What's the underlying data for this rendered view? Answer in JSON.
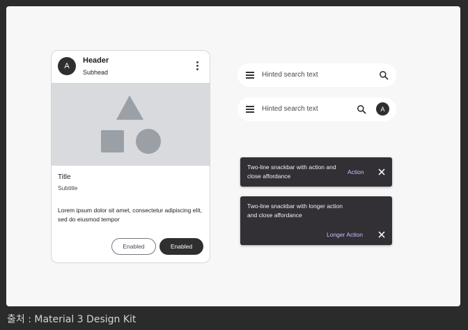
{
  "card": {
    "avatar_letter": "A",
    "header": "Header",
    "subhead": "Subhead",
    "title": "Title",
    "subtitle": "Subtitle",
    "body": "Lorem ipsum dolor sit amet, consectetur adipiscing elit, sed do eiusmod tempor",
    "outlined_button": "Enabled",
    "filled_button": "Enabled"
  },
  "search_bars": [
    {
      "hint": "Hinted search text"
    },
    {
      "hint": "Hinted search text",
      "avatar_letter": "A"
    }
  ],
  "snackbars": [
    {
      "text": "Two-line snackbar with action and close affordance",
      "action": "Action"
    },
    {
      "text": "Two-line snackbar with longer action and close affordance",
      "action": "Longer Action"
    }
  ],
  "caption": "출처 : Material 3 Design Kit",
  "colors": {
    "page_bg": "#2b2b2b",
    "canvas_bg": "#f7f7f7",
    "media_bg": "#d9dade",
    "shape": "#9aa0a6",
    "snackbar_bg": "#322f35",
    "snackbar_action": "#d0bcff",
    "filled_button": "#2f2f2f"
  }
}
